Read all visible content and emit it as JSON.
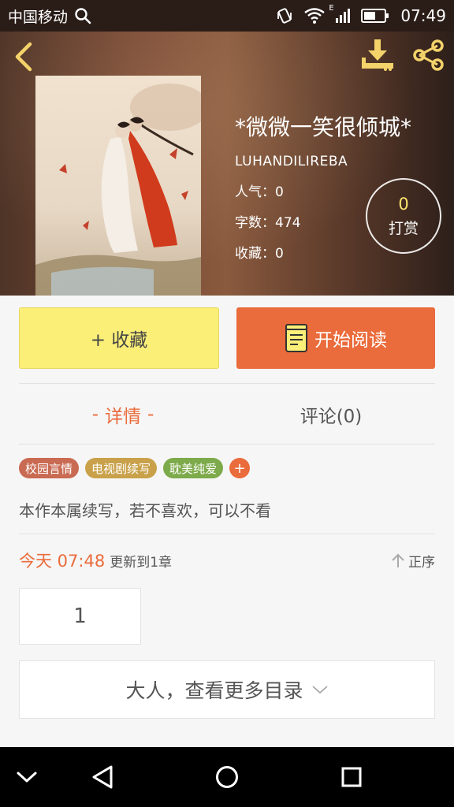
{
  "status_bar": {
    "carrier": "中国移动",
    "time": "07:49",
    "network_label": "E"
  },
  "book": {
    "title": "*微微一笑很倾城*",
    "author": "LUHANDILIREBA",
    "popularity": "人气：0",
    "word_count": "字数：474",
    "favorites": "收藏：0",
    "tip_count": "0",
    "tip_label": "打赏"
  },
  "actions": {
    "collect_label": "+ 收藏",
    "read_label": "开始阅读"
  },
  "tabs": {
    "detail_dash": "-",
    "detail": "详情",
    "comment": "评论(0)"
  },
  "tags": [
    {
      "label": "校园言情",
      "color": "#c96a52"
    },
    {
      "label": "电视剧续写",
      "color": "#c9a14a"
    },
    {
      "label": "耽美纯爱",
      "color": "#7daa4a"
    }
  ],
  "tag_add_label": "+",
  "summary": "本作本属续写，若不喜欢，可以不看",
  "update": {
    "time": "今天 07:48",
    "text": "更新到1章",
    "sort_label": "正序"
  },
  "chapter_page": "1",
  "more_label": "大人，查看更多目录",
  "colors": {
    "accent": "#ea6b3b",
    "collect_bg": "#fbef78",
    "tip_number": "#ffe56e"
  }
}
